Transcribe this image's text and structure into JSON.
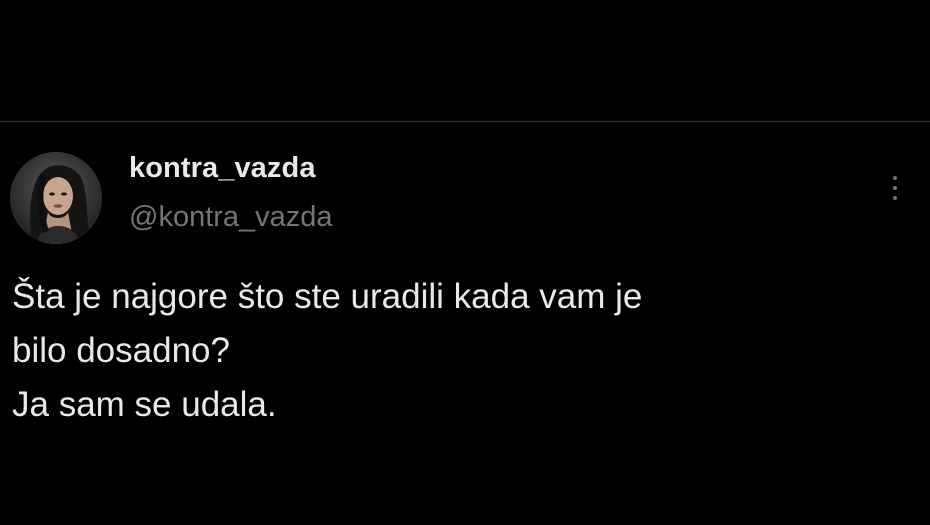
{
  "tweet": {
    "author": {
      "display_name": "kontra_vazda",
      "handle": "@kontra_vazda",
      "avatar_icon": "profile-photo"
    },
    "menu_icon": "more-vertical-icon",
    "text_lines": [
      "Šta je najgore što ste uradili kada vam je",
      "bilo dosadno?",
      "Ja sam se udala."
    ]
  },
  "colors": {
    "background": "#000000",
    "primary_text": "#e7e9ea",
    "secondary_text": "#71767b",
    "divider": "#2f3336"
  }
}
